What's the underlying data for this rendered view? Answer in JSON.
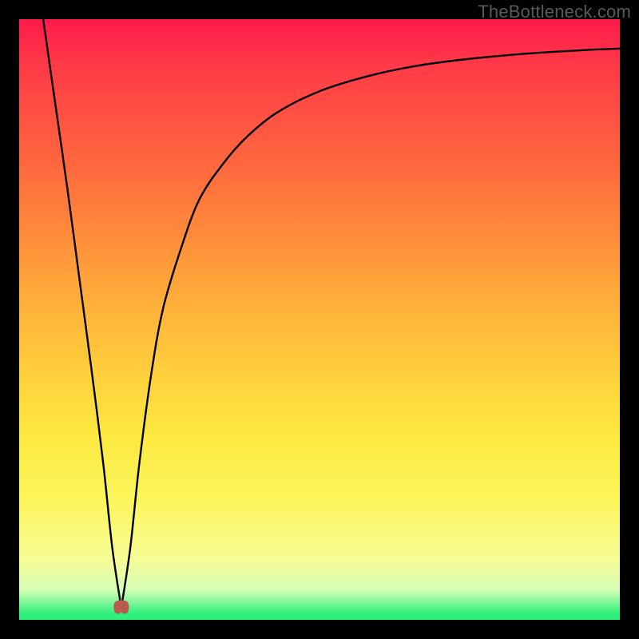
{
  "brand": "TheBottleneck.com",
  "colors": {
    "frame": "#000000",
    "gradient_top": "#ff1a4b",
    "gradient_mid1": "#ff8f3a",
    "gradient_mid2": "#fdea42",
    "gradient_bottom": "#2ef07a",
    "curve": "#000000",
    "min_marker": "#b85a4d"
  },
  "chart_data": {
    "type": "line",
    "title": "",
    "xlabel": "",
    "ylabel": "",
    "xlim": [
      0,
      100
    ],
    "ylim": [
      0,
      100
    ],
    "grid": false,
    "legend": false,
    "description": "Single V-shaped bottleneck curve on a red-to-green vertical gradient. Minimum near x≈17, y≈2. Left branch nearly vertical from top-left; right branch rises steeply then levels off toward upper right.",
    "series": [
      {
        "name": "bottleneck-curve",
        "x": [
          4,
          6,
          8,
          10,
          12,
          14,
          15.5,
          17,
          18.5,
          20,
          22,
          24,
          27,
          30,
          34,
          38,
          43,
          50,
          58,
          66,
          75,
          85,
          95,
          100
        ],
        "y": [
          100,
          86,
          72,
          57,
          42,
          26,
          12,
          2,
          12,
          26,
          41,
          52,
          62,
          70,
          76,
          80.5,
          84.5,
          88,
          90.5,
          92.2,
          93.4,
          94.3,
          94.9,
          95.1
        ]
      }
    ],
    "min_point": {
      "x": 17,
      "y": 2
    }
  }
}
